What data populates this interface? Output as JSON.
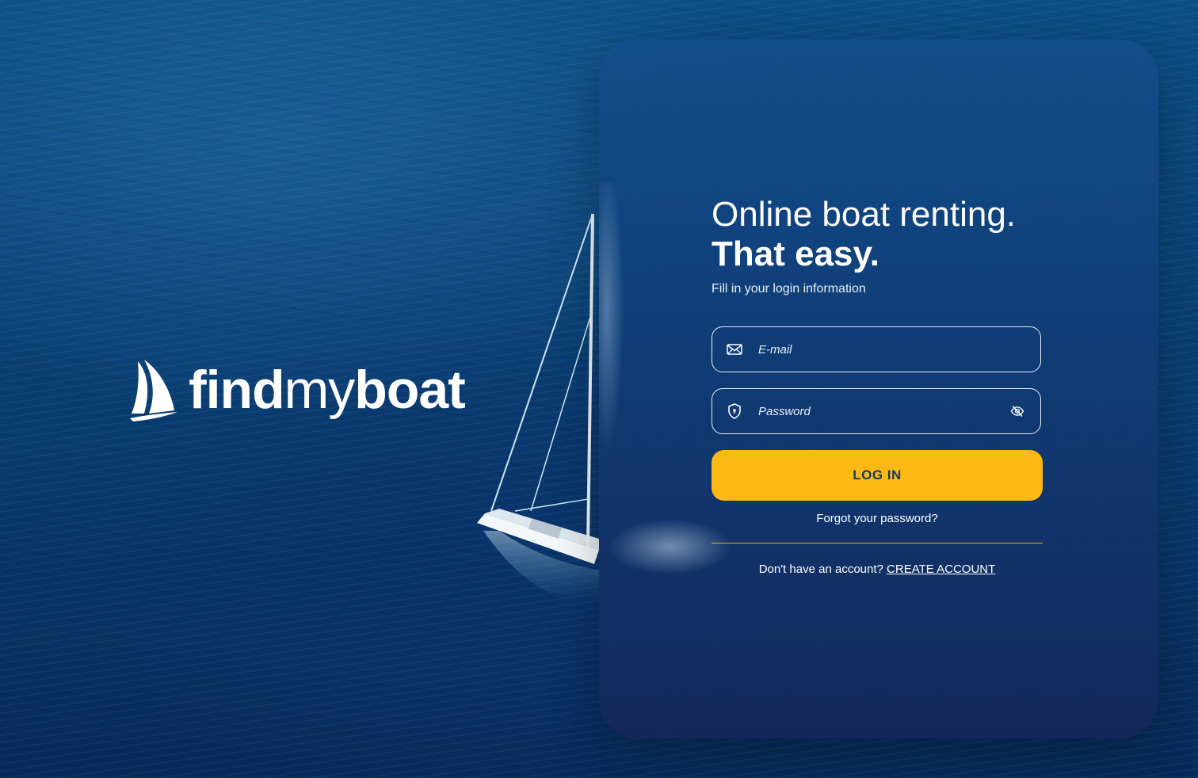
{
  "brand": {
    "name_bold_1": "find",
    "name_light": "my",
    "name_bold_2": "boat",
    "logo_icon": "sailboat-icon"
  },
  "login": {
    "headline": "Online boat renting.",
    "headline_bold": "That easy.",
    "subtitle": "Fill in your login information",
    "email": {
      "placeholder": "E-mail",
      "icon": "envelope-icon",
      "value": ""
    },
    "password": {
      "placeholder": "Password",
      "icon": "shield-lock-icon",
      "toggle_icon": "eye-off-icon",
      "value": ""
    },
    "login_button": "LOG IN",
    "forgot_link": "Forgot your password?",
    "signup_prompt": "Don't have an account?",
    "signup_link": "CREATE ACCOUNT"
  },
  "colors": {
    "accent": "#fdb913",
    "button_text": "#173a63",
    "divider": "#e1a626",
    "ocean": "#0a4479"
  }
}
